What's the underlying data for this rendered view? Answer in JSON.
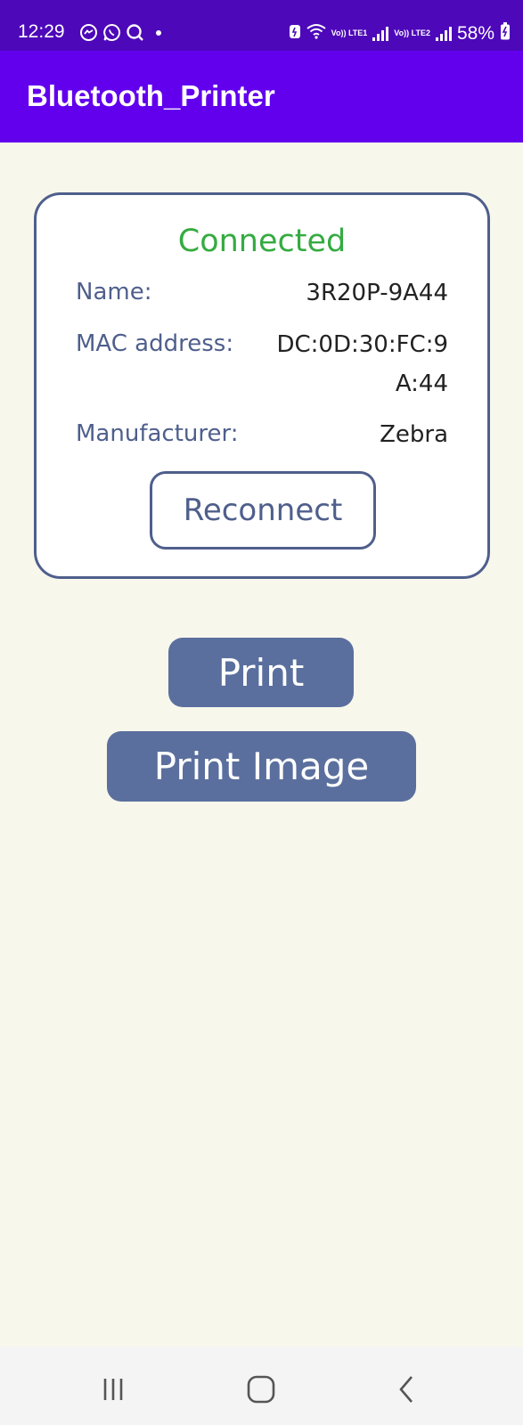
{
  "status_bar": {
    "time": "12:29",
    "notification_icons": [
      "messenger-icon",
      "whatsapp-icon",
      "search-icon"
    ],
    "network_1": "Vo)) LTE1",
    "network_2": "Vo)) LTE2",
    "battery": "58%"
  },
  "app_bar": {
    "title": "Bluetooth_Printer"
  },
  "printer_card": {
    "status": "Connected",
    "name_label": "Name:",
    "name_value": "3R20P-9A44",
    "mac_label": "MAC address:",
    "mac_value_line1": "DC:0D:30:FC:9",
    "mac_value_line2": "A:44",
    "manufacturer_label": "Manufacturer:",
    "manufacturer_value": "Zebra",
    "reconnect_label": "Reconnect"
  },
  "actions": {
    "print_label": "Print",
    "print_image_label": "Print Image"
  },
  "colors": {
    "status_bar": "#4d08b9",
    "app_bar": "#6200ee",
    "background": "#f8f7ec",
    "connected_text": "#35ab41",
    "accent": "#4f5f8c",
    "button_fill": "#5a6f9d"
  },
  "nav_bar": {
    "items": [
      "recent-apps-icon",
      "home-icon",
      "back-icon"
    ]
  }
}
